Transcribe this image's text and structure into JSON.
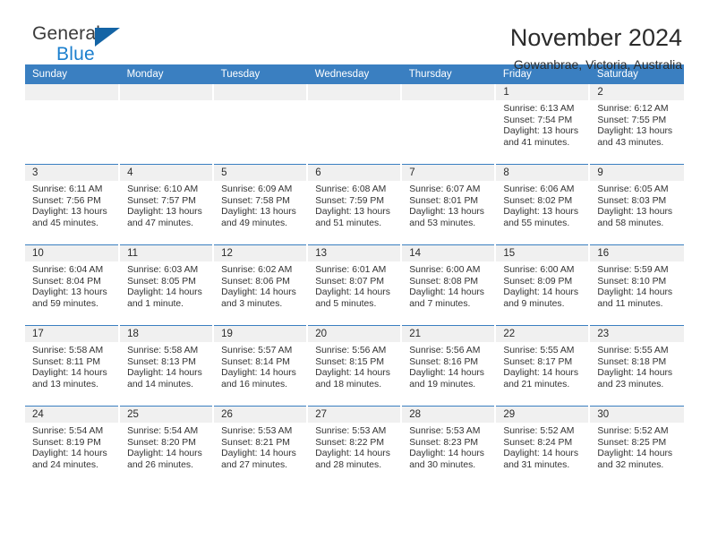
{
  "brand": {
    "name_part1": "General",
    "name_part2": "Blue",
    "triangle_color": "#1464a5",
    "blue_color": "#1b7fce"
  },
  "header": {
    "title": "November 2024",
    "subtitle": "Gowanbrae, Victoria, Australia"
  },
  "theme": {
    "header_bg": "#3a7fc1",
    "daynum_bg": "#f0f0f0",
    "text_color": "#333333"
  },
  "calendar": {
    "weekday_headers": [
      "Sunday",
      "Monday",
      "Tuesday",
      "Wednesday",
      "Thursday",
      "Friday",
      "Saturday"
    ],
    "labels": {
      "sunrise": "Sunrise:",
      "sunset": "Sunset:",
      "daylight": "Daylight:"
    },
    "weeks": [
      [
        {
          "day": "",
          "empty": true
        },
        {
          "day": "",
          "empty": true
        },
        {
          "day": "",
          "empty": true
        },
        {
          "day": "",
          "empty": true
        },
        {
          "day": "",
          "empty": true
        },
        {
          "day": "1",
          "sunrise": "Sunrise: 6:13 AM",
          "sunset": "Sunset: 7:54 PM",
          "daylight1": "Daylight: 13 hours",
          "daylight2": "and 41 minutes."
        },
        {
          "day": "2",
          "sunrise": "Sunrise: 6:12 AM",
          "sunset": "Sunset: 7:55 PM",
          "daylight1": "Daylight: 13 hours",
          "daylight2": "and 43 minutes."
        }
      ],
      [
        {
          "day": "3",
          "sunrise": "Sunrise: 6:11 AM",
          "sunset": "Sunset: 7:56 PM",
          "daylight1": "Daylight: 13 hours",
          "daylight2": "and 45 minutes."
        },
        {
          "day": "4",
          "sunrise": "Sunrise: 6:10 AM",
          "sunset": "Sunset: 7:57 PM",
          "daylight1": "Daylight: 13 hours",
          "daylight2": "and 47 minutes."
        },
        {
          "day": "5",
          "sunrise": "Sunrise: 6:09 AM",
          "sunset": "Sunset: 7:58 PM",
          "daylight1": "Daylight: 13 hours",
          "daylight2": "and 49 minutes."
        },
        {
          "day": "6",
          "sunrise": "Sunrise: 6:08 AM",
          "sunset": "Sunset: 7:59 PM",
          "daylight1": "Daylight: 13 hours",
          "daylight2": "and 51 minutes."
        },
        {
          "day": "7",
          "sunrise": "Sunrise: 6:07 AM",
          "sunset": "Sunset: 8:01 PM",
          "daylight1": "Daylight: 13 hours",
          "daylight2": "and 53 minutes."
        },
        {
          "day": "8",
          "sunrise": "Sunrise: 6:06 AM",
          "sunset": "Sunset: 8:02 PM",
          "daylight1": "Daylight: 13 hours",
          "daylight2": "and 55 minutes."
        },
        {
          "day": "9",
          "sunrise": "Sunrise: 6:05 AM",
          "sunset": "Sunset: 8:03 PM",
          "daylight1": "Daylight: 13 hours",
          "daylight2": "and 58 minutes."
        }
      ],
      [
        {
          "day": "10",
          "sunrise": "Sunrise: 6:04 AM",
          "sunset": "Sunset: 8:04 PM",
          "daylight1": "Daylight: 13 hours",
          "daylight2": "and 59 minutes."
        },
        {
          "day": "11",
          "sunrise": "Sunrise: 6:03 AM",
          "sunset": "Sunset: 8:05 PM",
          "daylight1": "Daylight: 14 hours",
          "daylight2": "and 1 minute."
        },
        {
          "day": "12",
          "sunrise": "Sunrise: 6:02 AM",
          "sunset": "Sunset: 8:06 PM",
          "daylight1": "Daylight: 14 hours",
          "daylight2": "and 3 minutes."
        },
        {
          "day": "13",
          "sunrise": "Sunrise: 6:01 AM",
          "sunset": "Sunset: 8:07 PM",
          "daylight1": "Daylight: 14 hours",
          "daylight2": "and 5 minutes."
        },
        {
          "day": "14",
          "sunrise": "Sunrise: 6:00 AM",
          "sunset": "Sunset: 8:08 PM",
          "daylight1": "Daylight: 14 hours",
          "daylight2": "and 7 minutes."
        },
        {
          "day": "15",
          "sunrise": "Sunrise: 6:00 AM",
          "sunset": "Sunset: 8:09 PM",
          "daylight1": "Daylight: 14 hours",
          "daylight2": "and 9 minutes."
        },
        {
          "day": "16",
          "sunrise": "Sunrise: 5:59 AM",
          "sunset": "Sunset: 8:10 PM",
          "daylight1": "Daylight: 14 hours",
          "daylight2": "and 11 minutes."
        }
      ],
      [
        {
          "day": "17",
          "sunrise": "Sunrise: 5:58 AM",
          "sunset": "Sunset: 8:11 PM",
          "daylight1": "Daylight: 14 hours",
          "daylight2": "and 13 minutes."
        },
        {
          "day": "18",
          "sunrise": "Sunrise: 5:58 AM",
          "sunset": "Sunset: 8:13 PM",
          "daylight1": "Daylight: 14 hours",
          "daylight2": "and 14 minutes."
        },
        {
          "day": "19",
          "sunrise": "Sunrise: 5:57 AM",
          "sunset": "Sunset: 8:14 PM",
          "daylight1": "Daylight: 14 hours",
          "daylight2": "and 16 minutes."
        },
        {
          "day": "20",
          "sunrise": "Sunrise: 5:56 AM",
          "sunset": "Sunset: 8:15 PM",
          "daylight1": "Daylight: 14 hours",
          "daylight2": "and 18 minutes."
        },
        {
          "day": "21",
          "sunrise": "Sunrise: 5:56 AM",
          "sunset": "Sunset: 8:16 PM",
          "daylight1": "Daylight: 14 hours",
          "daylight2": "and 19 minutes."
        },
        {
          "day": "22",
          "sunrise": "Sunrise: 5:55 AM",
          "sunset": "Sunset: 8:17 PM",
          "daylight1": "Daylight: 14 hours",
          "daylight2": "and 21 minutes."
        },
        {
          "day": "23",
          "sunrise": "Sunrise: 5:55 AM",
          "sunset": "Sunset: 8:18 PM",
          "daylight1": "Daylight: 14 hours",
          "daylight2": "and 23 minutes."
        }
      ],
      [
        {
          "day": "24",
          "sunrise": "Sunrise: 5:54 AM",
          "sunset": "Sunset: 8:19 PM",
          "daylight1": "Daylight: 14 hours",
          "daylight2": "and 24 minutes."
        },
        {
          "day": "25",
          "sunrise": "Sunrise: 5:54 AM",
          "sunset": "Sunset: 8:20 PM",
          "daylight1": "Daylight: 14 hours",
          "daylight2": "and 26 minutes."
        },
        {
          "day": "26",
          "sunrise": "Sunrise: 5:53 AM",
          "sunset": "Sunset: 8:21 PM",
          "daylight1": "Daylight: 14 hours",
          "daylight2": "and 27 minutes."
        },
        {
          "day": "27",
          "sunrise": "Sunrise: 5:53 AM",
          "sunset": "Sunset: 8:22 PM",
          "daylight1": "Daylight: 14 hours",
          "daylight2": "and 28 minutes."
        },
        {
          "day": "28",
          "sunrise": "Sunrise: 5:53 AM",
          "sunset": "Sunset: 8:23 PM",
          "daylight1": "Daylight: 14 hours",
          "daylight2": "and 30 minutes."
        },
        {
          "day": "29",
          "sunrise": "Sunrise: 5:52 AM",
          "sunset": "Sunset: 8:24 PM",
          "daylight1": "Daylight: 14 hours",
          "daylight2": "and 31 minutes."
        },
        {
          "day": "30",
          "sunrise": "Sunrise: 5:52 AM",
          "sunset": "Sunset: 8:25 PM",
          "daylight1": "Daylight: 14 hours",
          "daylight2": "and 32 minutes."
        }
      ]
    ]
  }
}
